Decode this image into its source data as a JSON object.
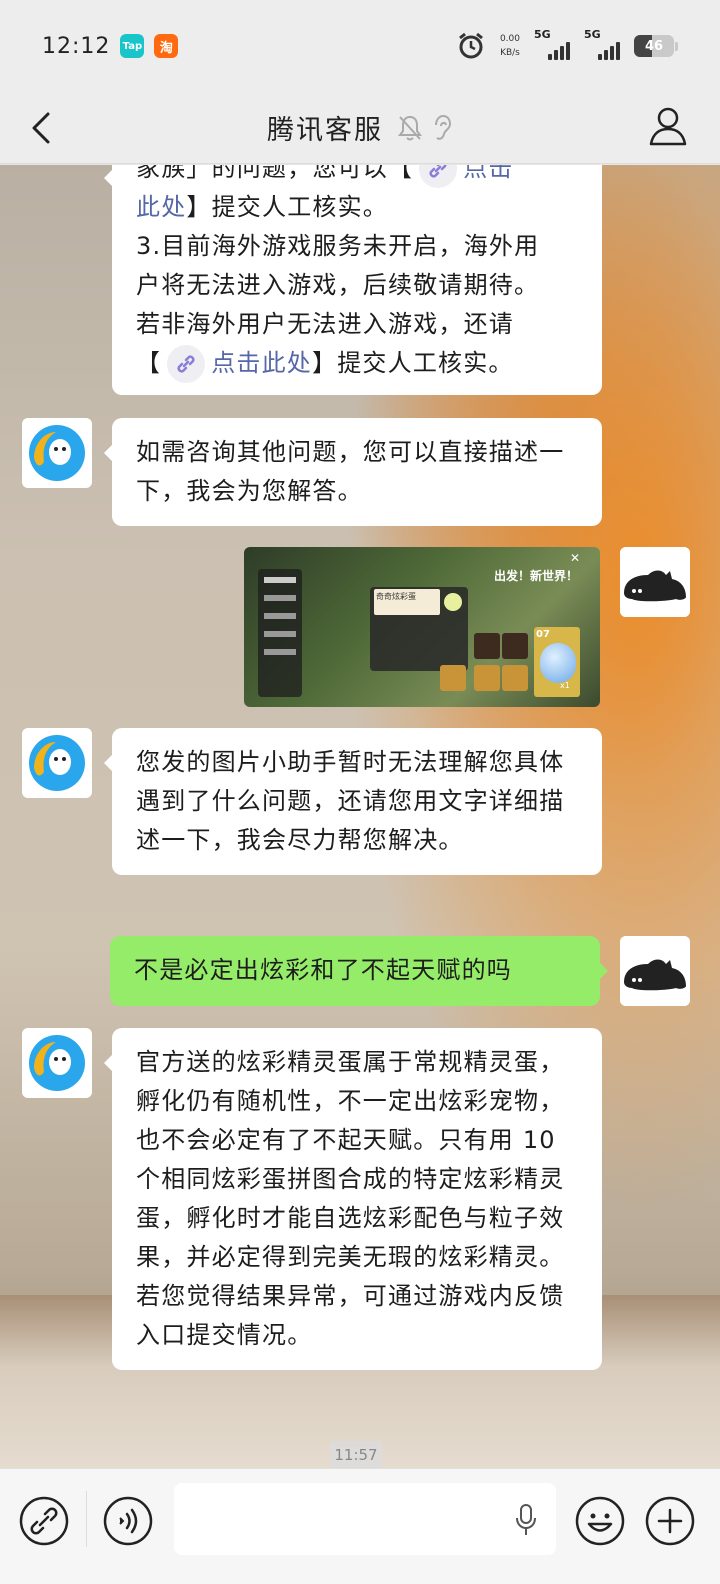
{
  "status_bar": {
    "time": "12:12",
    "apps": [
      {
        "name": "TapTap",
        "label": "Tap",
        "color": "#18c5c9"
      },
      {
        "name": "Taobao",
        "label": "淘",
        "color": "#ff6a10"
      }
    ],
    "net_speed_value": "0.00",
    "net_speed_unit": "KB/s",
    "signal1": "5G",
    "signal2": "5G",
    "battery": "46"
  },
  "header": {
    "title": "腾讯客服"
  },
  "messages": [
    {
      "side": "left",
      "line_top": "家族」的问题，您可以【",
      "line_top_link": "点击",
      "line2_link": "此处",
      "line2": "】提交人工核实。",
      "line3": "3.目前海外游戏服务未开启，海外用",
      "line4": "户将无法进入游戏，后续敬请期待。",
      "line5": "若非海外用户无法进入游戏，还请",
      "line6_pre": "【",
      "line6_link": "点击此处",
      "line6_post": "】提交人工核实。"
    },
    {
      "side": "left",
      "text": "如需咨询其他问题，您可以直接描述一下，我会为您解答。"
    },
    {
      "side": "right",
      "type": "image"
    },
    {
      "side": "left",
      "text": "您发的图片小助手暂时无法理解您具体遇到了什么问题，还请您用文字详细描述一下，我会尽力帮您解决。"
    },
    {
      "side": "right",
      "text": "不是必定出炫彩和了不起天赋的吗"
    },
    {
      "side": "left",
      "text": "官方送的炫彩精灵蛋属于常规精灵蛋，孵化仍有随机性，不一定出炫彩宠物，也不会必定有了不起天赋。只有用 10 个相同炫彩蛋拼图合成的特定炫彩精灵蛋，孵化时才能自选炫彩配色与粒子效果，并必定得到完美无瑕的炫彩精灵。若您觉得结果异常，可通过游戏内反馈入口提交情况。"
    }
  ],
  "screenshot": {
    "banner": "出发！新世界！",
    "card_title": "奇奇炫彩蛋",
    "card_count": "07",
    "card_multiplier": "x1"
  },
  "timestamp": "11:57",
  "colors": {
    "bubble_self": "#95ec69",
    "bubble_other": "#ffffff",
    "link": "#5667a8"
  }
}
